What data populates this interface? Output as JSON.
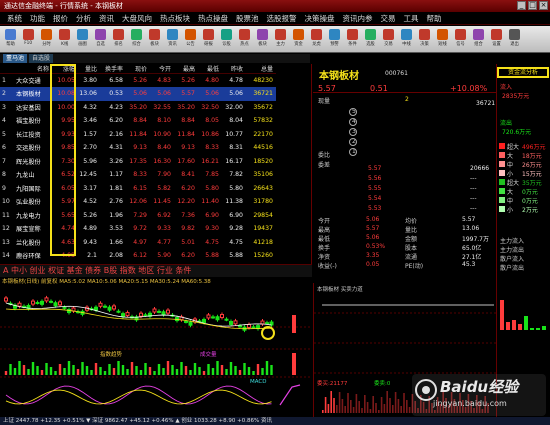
{
  "window": {
    "title": "通达信金融终端 - 行情系统 - 本钢板材"
  },
  "menu": [
    "系统",
    "功能",
    "报价",
    "分析",
    "资讯",
    "大盘风向",
    "热点板块",
    "热点操盘",
    "股票池",
    "选股报警",
    "决策操盘",
    "资讯内参",
    "交易",
    "工具",
    "帮助"
  ],
  "toolbar": [
    {
      "label": "帮助",
      "color": "#4a7bd0"
    },
    {
      "label": "F10",
      "color": "#c0392b"
    },
    {
      "label": "分时",
      "color": "#d35400"
    },
    {
      "label": "K线",
      "color": "#c0392b"
    },
    {
      "label": "画图",
      "color": "#2e86c1"
    },
    {
      "label": "自选",
      "color": "#8e44ad"
    },
    {
      "label": "排名",
      "color": "#c0392b"
    },
    {
      "label": "综合",
      "color": "#27ae60"
    },
    {
      "label": "板块",
      "color": "#c0392b"
    },
    {
      "label": "资讯",
      "color": "#2e86c1"
    },
    {
      "label": "公告",
      "color": "#d35400"
    },
    {
      "label": "研报",
      "color": "#c0392b"
    },
    {
      "label": "诊股",
      "color": "#16a085"
    },
    {
      "label": "热点",
      "color": "#c0392b"
    },
    {
      "label": "板块",
      "color": "#8e44ad"
    },
    {
      "label": "主力",
      "color": "#c0392b"
    },
    {
      "label": "资金",
      "color": "#d35400"
    },
    {
      "label": "龙虎",
      "color": "#c0392b"
    },
    {
      "label": "预警",
      "color": "#2e86c1"
    },
    {
      "label": "条件",
      "color": "#c0392b"
    },
    {
      "label": "选股",
      "color": "#27ae60"
    },
    {
      "label": "交易",
      "color": "#c0392b"
    },
    {
      "label": "中线",
      "color": "#2e86c1"
    },
    {
      "label": "决策",
      "color": "#c0392b"
    },
    {
      "label": "短线",
      "color": "#d35400"
    },
    {
      "label": "信号",
      "color": "#c0392b"
    },
    {
      "label": "组合",
      "color": "#8e44ad"
    },
    {
      "label": "设置",
      "color": "#c0392b"
    },
    {
      "label": "退出",
      "color": "#555"
    }
  ],
  "tabs": [
    "董马池",
    "自选股"
  ],
  "quote_table": {
    "headers": [
      "",
      "名称",
      "涨幅",
      "量比",
      "换手率",
      "现价",
      "今开",
      "最高",
      "最低",
      "昨收",
      "总量"
    ],
    "rows": [
      {
        "no": "1",
        "name": "大众交通",
        "pct": "10.05",
        "vr": "3.80",
        "turn": "6.58",
        "price": "5.26",
        "open": "4.83",
        "high": "5.26",
        "low": "4.80",
        "prev": "4.78",
        "vol": "48230"
      },
      {
        "no": "2",
        "name": "本钢板材",
        "pct": "10.08",
        "vr": "13.06",
        "turn": "0.53",
        "price": "5.06",
        "open": "5.06",
        "high": "5.57",
        "low": "5.06",
        "prev": "5.06",
        "vol": "36721"
      },
      {
        "no": "3",
        "name": "达安基因",
        "pct": "10.00",
        "vr": "4.32",
        "turn": "4.23",
        "price": "35.20",
        "open": "32.55",
        "high": "35.20",
        "low": "32.50",
        "prev": "32.00",
        "vol": "35672"
      },
      {
        "no": "4",
        "name": "福宝股份",
        "pct": "9.95",
        "vr": "3.46",
        "turn": "6.20",
        "price": "8.84",
        "open": "8.10",
        "high": "8.84",
        "low": "8.05",
        "prev": "8.04",
        "vol": "57832"
      },
      {
        "no": "5",
        "name": "长江投资",
        "pct": "9.93",
        "vr": "1.57",
        "turn": "2.16",
        "price": "11.84",
        "open": "10.90",
        "high": "11.84",
        "low": "10.86",
        "prev": "10.77",
        "vol": "22170"
      },
      {
        "no": "6",
        "name": "交运股份",
        "pct": "9.85",
        "vr": "2.70",
        "turn": "4.31",
        "price": "9.13",
        "open": "8.40",
        "high": "9.13",
        "low": "8.33",
        "prev": "8.31",
        "vol": "44516"
      },
      {
        "no": "7",
        "name": "辉光股份",
        "pct": "7.30",
        "vr": "5.96",
        "turn": "3.26",
        "price": "17.35",
        "open": "16.30",
        "high": "17.60",
        "low": "16.21",
        "prev": "16.17",
        "vol": "18520"
      },
      {
        "no": "8",
        "name": "九龙山",
        "pct": "6.52",
        "vr": "12.45",
        "turn": "1.17",
        "price": "8.33",
        "open": "7.90",
        "high": "8.41",
        "low": "7.85",
        "prev": "7.82",
        "vol": "35106"
      },
      {
        "no": "9",
        "name": "九阳国际",
        "pct": "6.05",
        "vr": "3.17",
        "turn": "1.81",
        "price": "6.15",
        "open": "5.82",
        "high": "6.20",
        "low": "5.80",
        "prev": "5.80",
        "vol": "26643"
      },
      {
        "no": "10",
        "name": "弘业股份",
        "pct": "5.97",
        "vr": "4.52",
        "turn": "2.76",
        "price": "12.06",
        "open": "11.45",
        "high": "12.20",
        "low": "11.40",
        "prev": "11.38",
        "vol": "31780"
      },
      {
        "no": "11",
        "name": "九龙电力",
        "pct": "5.65",
        "vr": "5.26",
        "turn": "1.96",
        "price": "7.29",
        "open": "6.92",
        "high": "7.36",
        "low": "6.90",
        "prev": "6.90",
        "vol": "29854"
      },
      {
        "no": "12",
        "name": "展宝宣称",
        "pct": "4.74",
        "vr": "4.89",
        "turn": "3.53",
        "price": "9.72",
        "open": "9.33",
        "high": "9.82",
        "low": "9.30",
        "prev": "9.28",
        "vol": "19437"
      },
      {
        "no": "13",
        "name": "兰化股份",
        "pct": "4.63",
        "vr": "9.43",
        "turn": "1.66",
        "price": "4.97",
        "open": "4.77",
        "high": "5.01",
        "low": "4.75",
        "prev": "4.75",
        "vol": "41218"
      },
      {
        "no": "14",
        "name": "鹿谷环保",
        "pct": "4.08",
        "vr": "2.1",
        "turn": "2.08",
        "price": "6.12",
        "open": "5.90",
        "high": "6.20",
        "low": "5.88",
        "prev": "5.88",
        "vol": "15260"
      }
    ]
  },
  "block_tabs": "A 中小 创业 权证 基金 债券 B股 指数 地区 行业 条件",
  "kline_info": "本钢板材(日线)  前复权  MA5:5.02  MA10:5.06  MA20:5.15  MA30:5.24  MA60:5.38",
  "kline_sub_labels": [
    "指数趋势",
    "成交量",
    "MACD"
  ],
  "detail": {
    "name": "本钢板材",
    "code": "000761",
    "price": "5.57",
    "change": "0.51",
    "pct": "+10.08%",
    "labels": [
      "现量",
      "委比",
      "委差"
    ],
    "values": [
      "2",
      "36721"
    ],
    "ask": [
      {
        "p": "5.57",
        "v": "20666"
      },
      {
        "p": "5.56",
        "v": "---"
      },
      {
        "p": "5.55",
        "v": "---"
      },
      {
        "p": "5.54",
        "v": "---"
      },
      {
        "p": "5.53",
        "v": "---"
      }
    ],
    "stats": [
      {
        "k": "今开",
        "v": "5.06",
        "k2": "均价",
        "v2": "5.57"
      },
      {
        "k": "最高",
        "v": "5.57",
        "k2": "量比",
        "v2": "13.06"
      },
      {
        "k": "最低",
        "v": "5.06",
        "k2": "金额",
        "v2": "1997.7万"
      },
      {
        "k": "换手",
        "v": "0.53%",
        "k2": "股本",
        "v2": "65.0亿"
      },
      {
        "k": "净资",
        "v": "3.35",
        "k2": "流通",
        "v2": "27.1亿"
      },
      {
        "k": "收益(-)",
        "v": "0.05",
        "k2": "PE(动)",
        "v2": "45.3"
      }
    ]
  },
  "capital": {
    "title": "资金流分析",
    "inflow_label": "流入",
    "inflow_value": "2835万元",
    "outflow_label": "流出",
    "outflow_value": "720.6万元",
    "legend": [
      {
        "k": "超大",
        "v": "496万元",
        "c": "#ff2020"
      },
      {
        "k": "大",
        "v": "18万元",
        "c": "#ff6060"
      },
      {
        "k": "中",
        "v": "26万元",
        "c": "#ff9090"
      },
      {
        "k": "小",
        "v": "15万元",
        "c": "#ffc0c0"
      },
      {
        "k": "超大",
        "v": "35万元",
        "c": "#20c020"
      },
      {
        "k": "大",
        "v": "0万元",
        "c": "#40e040"
      },
      {
        "k": "中",
        "v": "0万元",
        "c": "#80f080"
      },
      {
        "k": "小",
        "v": "2万元",
        "c": "#b0ffb0"
      }
    ],
    "sub_labels": [
      "主力流入",
      "主力流出",
      "散户流入",
      "散户流出"
    ]
  },
  "mini": {
    "title": "本钢板材  买卖力道",
    "labels": [
      "委买:21177",
      "委卖:0"
    ]
  },
  "status": "上证 2447.78  +12.35  +0.51%  ▼  深证 9862.47  +45.12  +0.46%  ▲  创业 1033.28  +8.90  +0.86%  资讯",
  "watermark": {
    "brand": "Baidu经验",
    "url": "jingyan.baidu.com"
  },
  "colors": {
    "up": "#ff3c3c",
    "down": "#19e319",
    "highlight": "#f5e11a",
    "selected": "#1a3c9a"
  }
}
